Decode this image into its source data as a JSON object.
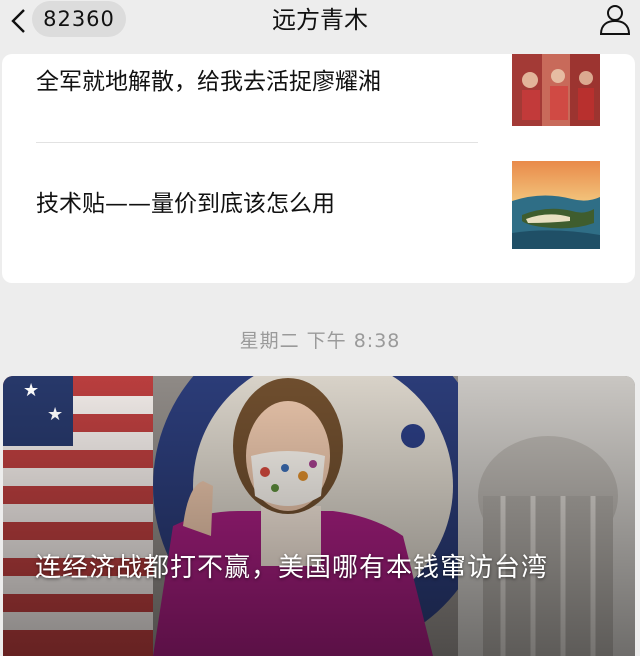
{
  "header": {
    "unread_count": "82360",
    "title": "远方青木",
    "back_icon": "chevron-left-icon",
    "profile_icon": "person-icon"
  },
  "articles": [
    {
      "title": "全军就地解散，给我去活捉廖耀湘"
    },
    {
      "title": "技术贴——量价到底该怎么用"
    }
  ],
  "timestamp": "星期二 下午 8:38",
  "featured": {
    "title": "连经济战都打不赢，美国哪有本钱窜访台湾"
  },
  "colors": {
    "background": "#ededed",
    "card": "#ffffff",
    "timestamp": "#9a9a9a"
  }
}
